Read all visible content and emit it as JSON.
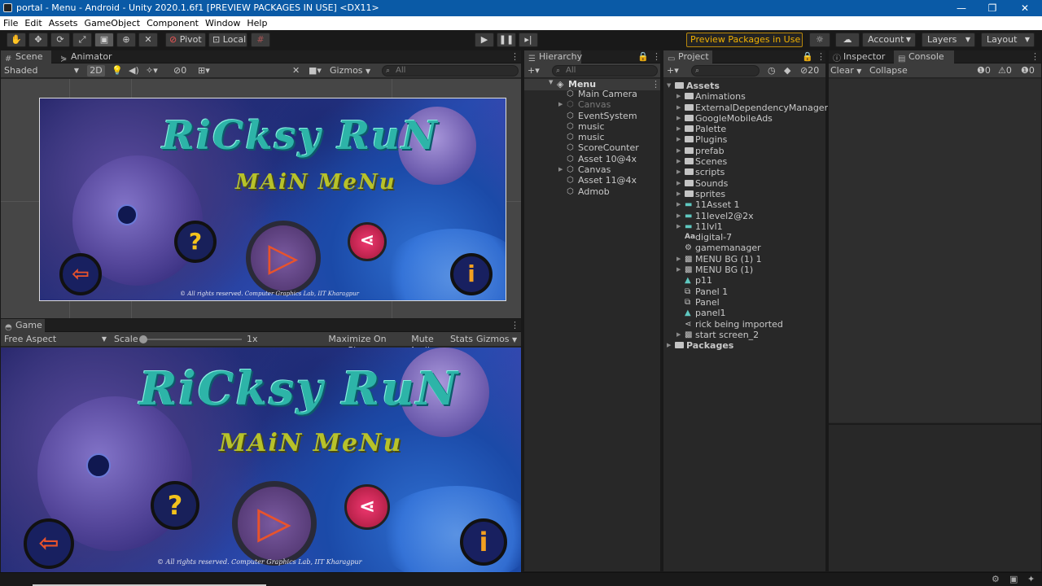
{
  "window": {
    "title": "portal - Menu - Android - Unity 2020.1.6f1 [PREVIEW PACKAGES IN USE] <DX11>",
    "minimize": "—",
    "maximize": "❐",
    "close": "✕"
  },
  "menu": [
    "File",
    "Edit",
    "Assets",
    "GameObject",
    "Component",
    "Window",
    "Help"
  ],
  "toolbar": {
    "pivot": "Pivot",
    "local": "Local",
    "preview_packages": "Preview Packages in Use ▾",
    "account": "Account",
    "layers": "Layers",
    "layout": "Layout"
  },
  "scene": {
    "tab_scene": "Scene",
    "tab_animator": "Animator",
    "shading": "Shaded",
    "mode_2d": "2D",
    "hidden_count": "0",
    "gizmos": "Gizmos",
    "search_placeholder": "All"
  },
  "game": {
    "tab": "Game",
    "aspect": "Free Aspect",
    "scale_label": "Scale",
    "scale_value": "1x",
    "maximize": "Maximize On Play",
    "mute": "Mute Audio",
    "stats": "Stats",
    "gizmos": "Gizmos"
  },
  "art": {
    "title": "RiCksy RuN",
    "subtitle": "MAiN MeNu",
    "copyright": "© All rights reserved. Computer Graphics Lab, IIT Kharagpur",
    "help_glyph": "?",
    "info_glyph": "i"
  },
  "hierarchy": {
    "tab": "Hierarchy",
    "search_placeholder": "All",
    "root": "Menu",
    "items": [
      {
        "label": "Main Camera",
        "fold": false,
        "dim": false
      },
      {
        "label": "Canvas",
        "fold": true,
        "dim": true
      },
      {
        "label": "EventSystem",
        "fold": false,
        "dim": false
      },
      {
        "label": "music",
        "fold": false,
        "dim": false
      },
      {
        "label": "music",
        "fold": false,
        "dim": false
      },
      {
        "label": "ScoreCounter",
        "fold": false,
        "dim": false
      },
      {
        "label": "Asset 10@4x",
        "fold": false,
        "dim": false
      },
      {
        "label": "Canvas",
        "fold": true,
        "dim": false
      },
      {
        "label": "Asset 11@4x",
        "fold": false,
        "dim": false
      },
      {
        "label": "Admob",
        "fold": false,
        "dim": false
      }
    ]
  },
  "project": {
    "tab": "Project",
    "hidden_count": "20",
    "root": "Assets",
    "items": [
      {
        "label": "Animations",
        "kind": "folder"
      },
      {
        "label": "ExternalDependencyManager",
        "kind": "folder"
      },
      {
        "label": "GoogleMobileAds",
        "kind": "folder"
      },
      {
        "label": "Palette",
        "kind": "folder"
      },
      {
        "label": "Plugins",
        "kind": "folder"
      },
      {
        "label": "prefab",
        "kind": "folder"
      },
      {
        "label": "Scenes",
        "kind": "folder"
      },
      {
        "label": "scripts",
        "kind": "folder"
      },
      {
        "label": "Sounds",
        "kind": "folder"
      },
      {
        "label": "sprites",
        "kind": "folder"
      },
      {
        "label": "11Asset 1",
        "kind": "sprite"
      },
      {
        "label": "11level2@2x",
        "kind": "sprite"
      },
      {
        "label": "11lvl1",
        "kind": "sprite"
      },
      {
        "label": "digital-7",
        "kind": "font"
      },
      {
        "label": "gamemanager",
        "kind": "gear"
      },
      {
        "label": "MENU BG (1) 1",
        "kind": "image"
      },
      {
        "label": "MENU BG (1)",
        "kind": "image"
      },
      {
        "label": "p11",
        "kind": "tri"
      },
      {
        "label": "Panel 1",
        "kind": "prefab"
      },
      {
        "label": "Panel",
        "kind": "prefab"
      },
      {
        "label": "panel1",
        "kind": "tri"
      },
      {
        "label": "rick being imported",
        "kind": "share"
      },
      {
        "label": "start screen_2",
        "kind": "image"
      }
    ],
    "packages": "Packages"
  },
  "inspector": {
    "tab_inspector": "Inspector",
    "tab_console": "Console",
    "clear": "Clear",
    "collapse": "Collapse",
    "count_info": "0",
    "count_warn": "0",
    "count_error": "0"
  }
}
